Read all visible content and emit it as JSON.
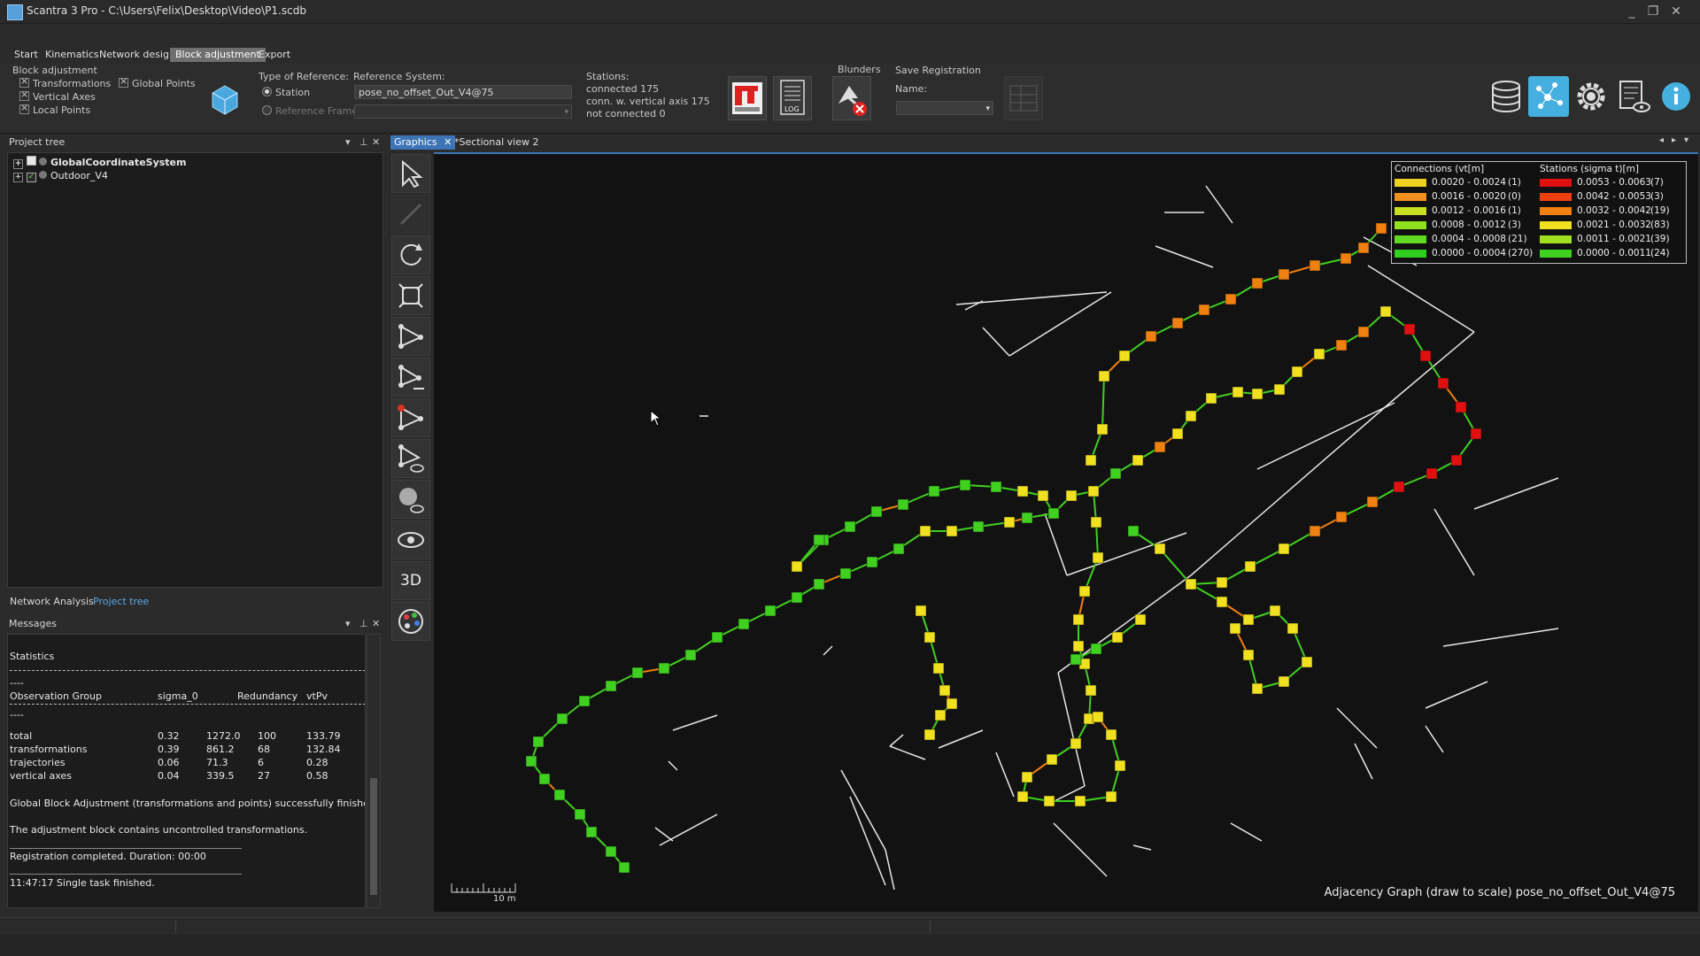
{
  "window": {
    "title": "Scantra 3 Pro - C:\\Users\\Felix\\Desktop\\Video\\P1.scdb",
    "controls": [
      "_",
      "❐",
      "✕"
    ]
  },
  "menu": {
    "tabs": [
      "Start",
      "Kinematics",
      "Network design",
      "Block adjustment",
      "Export"
    ],
    "active": "Block adjustment"
  },
  "ribbon": {
    "group_label": "Block adjustment",
    "check_transformations": "Transformations",
    "check_global_points": "Global Points",
    "check_vertical_axes": "Vertical Axes",
    "check_local_points": "Local Points",
    "type_of_reference_label": "Type of Reference:",
    "radio_station": "Station",
    "radio_reference_frame": "Reference Frame",
    "reference_system_label": "Reference System:",
    "reference_system_value": "pose_no_offset_Out_V4@75",
    "stations_label": "Stations:",
    "stations_connected": "connected 175",
    "stations_vertical": "conn. w. vertical axis 175",
    "stations_not_connected": "not connected 0",
    "log_label": "LOG",
    "blunders_label": "Blunders",
    "save_registration_label": "Save Registration",
    "name_label": "Name:"
  },
  "project_tree": {
    "title": "Project tree",
    "items": [
      "GlobalCoordinateSystem",
      "Outdoor_V4"
    ],
    "controls": [
      "▾",
      "⊥",
      "✕"
    ]
  },
  "bottom_tabs": [
    "Network Analysis",
    "Project tree"
  ],
  "messages": {
    "title": "Messages",
    "statistics": "Statistics",
    "sep": "----",
    "headers": [
      "Observation Group",
      "sigma_0",
      "Redundancy",
      "vtPv"
    ],
    "rows": [
      [
        "total",
        "0.32",
        "1272.0",
        "100",
        "133.79"
      ],
      [
        "transformations",
        "0.39",
        "861.2",
        "68",
        "132.84"
      ],
      [
        "trajectories",
        "0.06",
        "71.3",
        "6",
        "0.28"
      ],
      [
        "vertical axes",
        "0.04",
        "339.5",
        "27",
        "0.58"
      ]
    ],
    "line1": "Global Block Adjustment (transformations and points) successfully finished.",
    "line2": "The adjustment block contains uncontrolled transformations.",
    "line3": "Registration completed. Duration: 00:00",
    "line4": "11:47:17 Single task finished."
  },
  "view_tabs": [
    "Graphics",
    "*Sectional view 2"
  ],
  "tools": {
    "three_d_label": "3D"
  },
  "legend": {
    "connections_title": "Connections (vt[m]",
    "stations_title": "Stations (sigma t)[m]",
    "connections": [
      {
        "range": "0.0020 - 0.0024",
        "count": "(1)",
        "color": "#f0d020"
      },
      {
        "range": "0.0016 - 0.0020",
        "count": "(0)",
        "color": "#f09020"
      },
      {
        "range": "0.0012 - 0.0016",
        "count": "(1)",
        "color": "#c8e020"
      },
      {
        "range": "0.0008 - 0.0012",
        "count": "(3)",
        "color": "#90e020"
      },
      {
        "range": "0.0004 - 0.0008",
        "count": "(21)",
        "color": "#60d820"
      },
      {
        "range": "0.0000 - 0.0004",
        "count": "(270)",
        "color": "#30d020"
      }
    ],
    "stations": [
      {
        "range": "0.0053 - 0.0063",
        "count": "(7)",
        "color": "#e01010"
      },
      {
        "range": "0.0042 - 0.0053",
        "count": "(3)",
        "color": "#f04010"
      },
      {
        "range": "0.0032 - 0.0042",
        "count": "(19)",
        "color": "#f08010"
      },
      {
        "range": "0.0021 - 0.0032",
        "count": "(83)",
        "color": "#f0e020"
      },
      {
        "range": "0.0011 - 0.0021",
        "count": "(39)",
        "color": "#a0e020"
      },
      {
        "range": "0.0000 - 0.0011",
        "count": "(24)",
        "color": "#40d020"
      }
    ]
  },
  "scale_label": "10 m",
  "graph_caption": "Adjacency Graph (draw to scale) pose_no_offset_Out_V4@75",
  "colors": {
    "station_green": "#40d020",
    "station_yellow": "#f0e020",
    "station_orange": "#f08010",
    "station_red": "#e01010",
    "accent_blue": "#3c74b6"
  }
}
